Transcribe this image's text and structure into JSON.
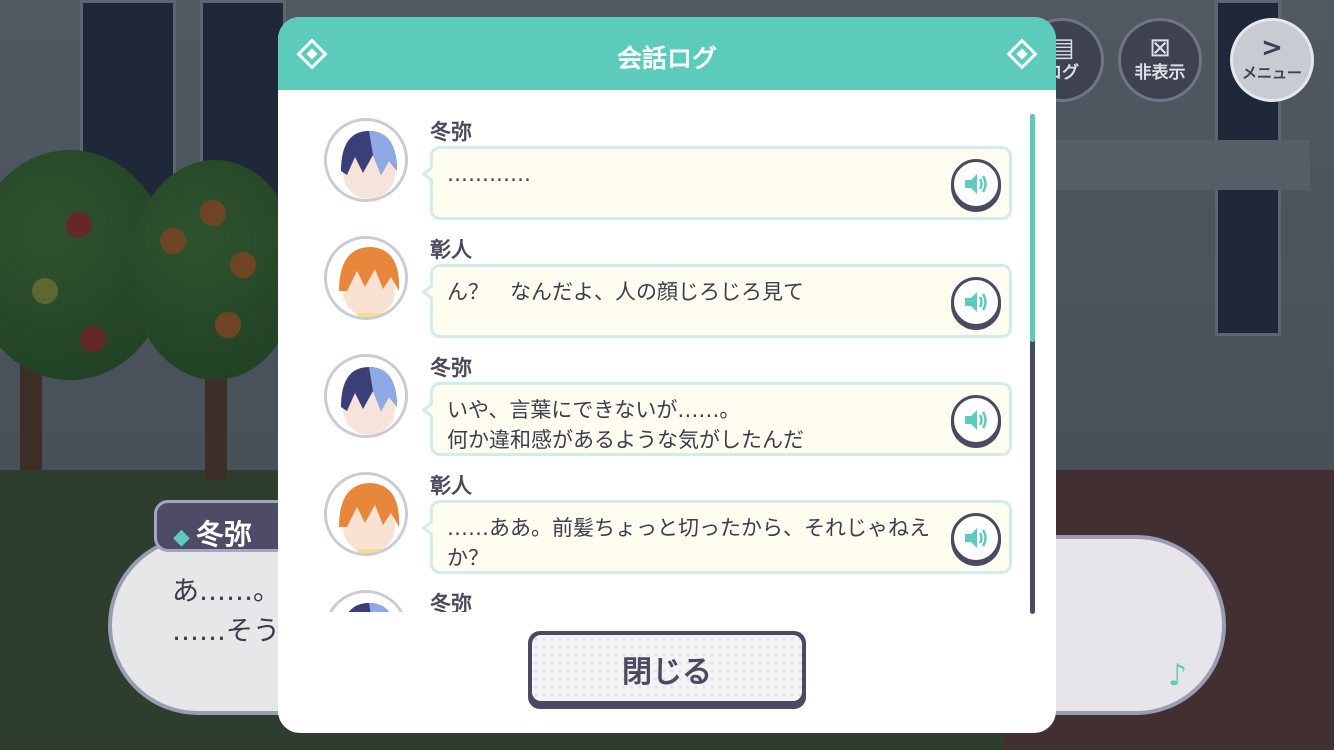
{
  "hud": {
    "log_label": "ログ",
    "hide_label": "非表示",
    "menu_label": "メニュー"
  },
  "dialogue": {
    "speaker": "冬弥",
    "line1": "あ……。",
    "line2": "……そう"
  },
  "log": {
    "title": "会話ログ",
    "entries": [
      {
        "speaker": "冬弥",
        "text": "…………",
        "character": "toya"
      },
      {
        "speaker": "彰人",
        "text": "ん？　なんだよ、人の顔じろじろ見て",
        "character": "akito"
      },
      {
        "speaker": "冬弥",
        "text": "いや、言葉にできないが……。\n何か違和感があるような気がしたんだ",
        "character": "toya"
      },
      {
        "speaker": "彰人",
        "text": "……ああ。前髪ちょっと切ったから、それじゃねえか？",
        "character": "akito"
      },
      {
        "speaker": "冬弥",
        "text": "",
        "character": "toya"
      }
    ],
    "close_label": "閉じる"
  },
  "colors": {
    "accent": "#5ccbbb",
    "dark": "#4b4a63",
    "bubble": "#fefdf0"
  }
}
